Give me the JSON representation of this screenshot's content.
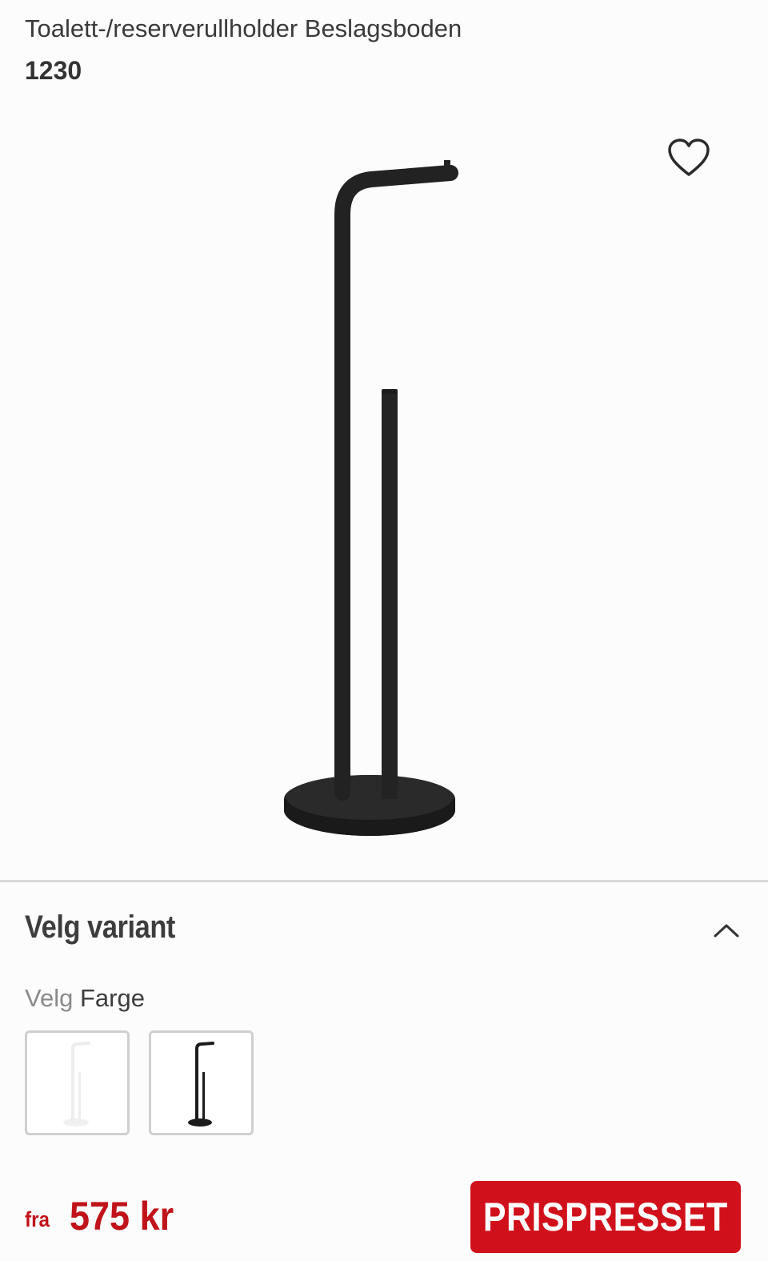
{
  "product": {
    "title": "Toalett-/reserverullholder Beslagsboden",
    "sku": "1230",
    "image_icon": "black-toilet-roll-holder-stand"
  },
  "favorite": {
    "icon": "heart-outline-icon"
  },
  "variant": {
    "title": "Velg variant",
    "toggle_icon": "chevron-up-icon",
    "color_label_prefix": "Velg",
    "color_label_attr": "Farge",
    "swatches": [
      {
        "color": "#ffffff",
        "selected": false
      },
      {
        "color": "#1c1c1c",
        "selected": false
      }
    ]
  },
  "price": {
    "from_label": "fra",
    "amount": "575 kr"
  },
  "badge": {
    "label": "PRISPRESSET",
    "color": "#d0111b"
  },
  "colors": {
    "accent": "#c0141a",
    "badge": "#d0111b"
  }
}
